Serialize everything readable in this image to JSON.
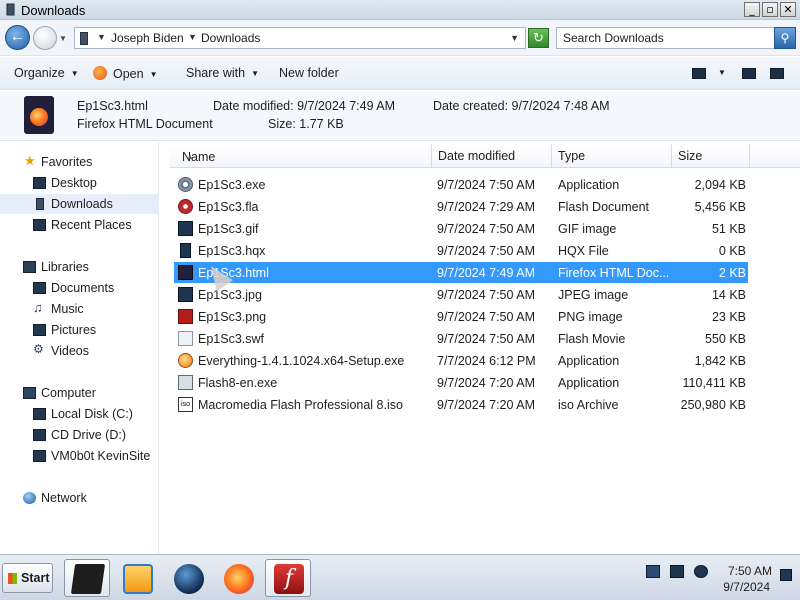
{
  "window": {
    "title": "Downloads",
    "controls": {
      "minimize": "_",
      "maximize": "▫",
      "close": "✕"
    }
  },
  "address": {
    "segments": [
      "Joseph Biden",
      "Downloads"
    ],
    "search_placeholder": "Search Downloads"
  },
  "toolbar": {
    "organize": "Organize",
    "open": "Open",
    "share_with": "Share with",
    "new_folder": "New folder"
  },
  "details": {
    "name": "Ep1Sc3.html",
    "type": "Firefox HTML Document",
    "date_modified": "Date modified:  9/7/2024 7:49 AM",
    "size": "Size:  1.77 KB",
    "date_created": "Date created:  9/7/2024 7:48 AM"
  },
  "navigation": {
    "favorites": {
      "label": "Favorites",
      "items": [
        "Desktop",
        "Downloads",
        "Recent Places"
      ]
    },
    "libraries": {
      "label": "Libraries",
      "items": [
        "Documents",
        "Music",
        "Pictures",
        "Videos"
      ]
    },
    "computer": {
      "label": "Computer",
      "items": [
        "Local Disk (C:)",
        "CD Drive (D:)",
        "VM0b0t KevinSite"
      ]
    },
    "network": {
      "label": "Network"
    },
    "selected": "Downloads"
  },
  "columns": {
    "name": "Name",
    "date_modified": "Date modified",
    "type": "Type",
    "size": "Size"
  },
  "files": [
    {
      "name": "Ep1Sc3.exe",
      "date": "9/7/2024 7:50 AM",
      "type": "Application",
      "size": "2,094 KB",
      "icon": "gear-icon"
    },
    {
      "name": "Ep1Sc3.fla",
      "date": "9/7/2024 7:29 AM",
      "type": "Flash Document",
      "size": "5,456 KB",
      "icon": "flash-doc-icon"
    },
    {
      "name": "Ep1Sc3.gif",
      "date": "9/7/2024 7:50 AM",
      "type": "GIF image",
      "size": "51 KB",
      "icon": "image-icon"
    },
    {
      "name": "Ep1Sc3.hqx",
      "date": "9/7/2024 7:50 AM",
      "type": "HQX File",
      "size": "0 KB",
      "icon": "file-icon"
    },
    {
      "name": "Ep1Sc3.html",
      "date": "9/7/2024 7:49 AM",
      "type": "Firefox HTML Doc...",
      "size": "2 KB",
      "icon": "firefox-html-icon",
      "selected": true
    },
    {
      "name": "Ep1Sc3.jpg",
      "date": "9/7/2024 7:50 AM",
      "type": "JPEG image",
      "size": "14 KB",
      "icon": "image-icon"
    },
    {
      "name": "Ep1Sc3.png",
      "date": "9/7/2024 7:50 AM",
      "type": "PNG image",
      "size": "23 KB",
      "icon": "png-icon"
    },
    {
      "name": "Ep1Sc3.swf",
      "date": "9/7/2024 7:50 AM",
      "type": "Flash Movie",
      "size": "550 KB",
      "icon": "swf-icon"
    },
    {
      "name": "Everything-1.4.1.1024.x64-Setup.exe",
      "date": "7/7/2024 6:12 PM",
      "type": "Application",
      "size": "1,842 KB",
      "icon": "everything-icon"
    },
    {
      "name": "Flash8-en.exe",
      "date": "9/7/2024 7:20 AM",
      "type": "Application",
      "size": "110,411 KB",
      "icon": "installer-icon"
    },
    {
      "name": "Macromedia Flash Professional 8.iso",
      "date": "9/7/2024 7:20 AM",
      "type": "iso Archive",
      "size": "250,980 KB",
      "icon": "iso-icon",
      "icon_text": "iso"
    }
  ],
  "taskbar": {
    "start": "Start",
    "time": "7:50 AM",
    "date": "9/7/2024",
    "flash_glyph": "f"
  },
  "colors": {
    "selection": "#3399ff",
    "nav_selected": "#e5eef9"
  }
}
